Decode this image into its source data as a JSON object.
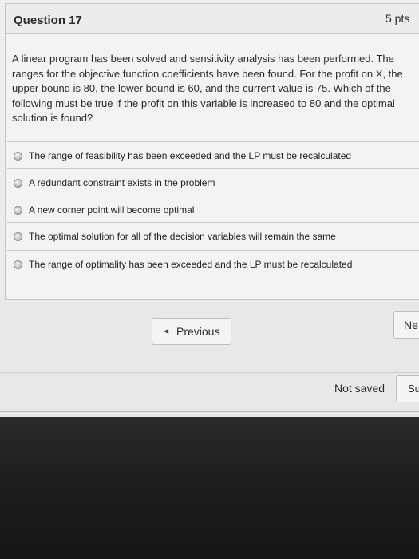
{
  "question": {
    "title": "Question 17",
    "points": "5 pts",
    "text": "A linear program has been solved and sensitivity analysis has been performed. The ranges for the objective function coefficients have been found. For the profit on X, the upper bound is 80, the lower bound is 60, and the current value is 75. Which of the following must be true if the profit on this variable is increased to 80 and the optimal solution is found?"
  },
  "answers": [
    {
      "label": "The range of feasibility has been exceeded and the LP must be recalculated"
    },
    {
      "label": "A redundant constraint exists in the problem"
    },
    {
      "label": "A new corner point will become optimal"
    },
    {
      "label": "The optimal solution for all of the decision variables will remain the same"
    },
    {
      "label": "The range of optimality has been exceeded and the LP must be recalculated"
    }
  ],
  "navigation": {
    "previous_label": "Previous",
    "previous_icon": "caret-left-icon",
    "next_label": "Ne",
    "save_status": "Not saved",
    "submit_label": "Su"
  }
}
